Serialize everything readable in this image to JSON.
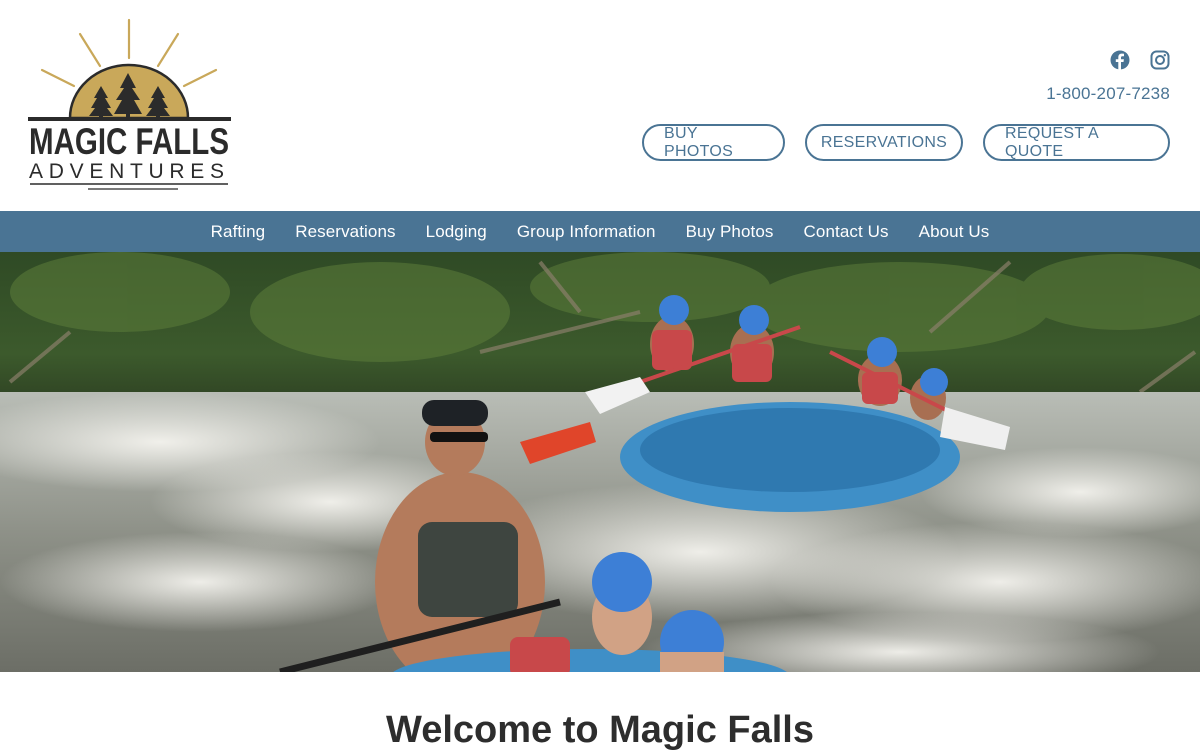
{
  "brand": {
    "logo_line1": "MAGIC FALLS",
    "logo_line2": "ADVENTURES",
    "colors": {
      "accent": "#4a7494",
      "logo_sun": "#c9a85a",
      "logo_text": "#2b2b2b"
    }
  },
  "header": {
    "social": [
      {
        "name": "facebook-icon"
      },
      {
        "name": "instagram-icon"
      }
    ],
    "phone": "1-800-207-7238",
    "buttons": {
      "buy_photos": "BUY PHOTOS",
      "reservations": "RESERVATIONS",
      "request_quote": "REQUEST A QUOTE"
    }
  },
  "nav": {
    "items": [
      {
        "label": "Rafting"
      },
      {
        "label": "Reservations"
      },
      {
        "label": "Lodging"
      },
      {
        "label": "Group Information"
      },
      {
        "label": "Buy Photos"
      },
      {
        "label": "Contact Us"
      },
      {
        "label": "About Us"
      }
    ]
  },
  "main": {
    "heading": "Welcome to Magic Falls"
  }
}
